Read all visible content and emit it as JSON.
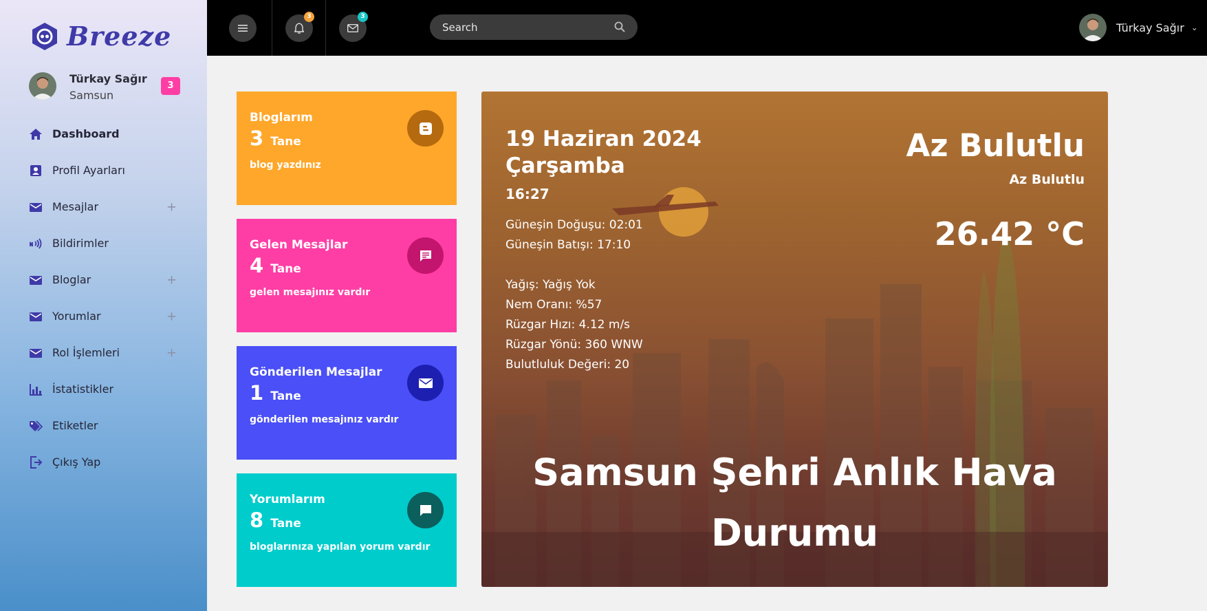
{
  "app": {
    "logo_text": "Breeze"
  },
  "sidebar": {
    "profile": {
      "name": "Türkay Sağır",
      "city": "Samsun",
      "badge": "3"
    },
    "items": [
      {
        "label": "Dashboard",
        "icon": "home-icon",
        "expandable": false
      },
      {
        "label": "Profil Ayarları",
        "icon": "profile-card-icon",
        "expandable": false
      },
      {
        "label": "Mesajlar",
        "icon": "mail-icon",
        "expandable": true
      },
      {
        "label": "Bildirimler",
        "icon": "broadcast-icon",
        "expandable": false
      },
      {
        "label": "Bloglar",
        "icon": "mail-icon",
        "expandable": true
      },
      {
        "label": "Yorumlar",
        "icon": "mail-icon",
        "expandable": true
      },
      {
        "label": "Rol İşlemleri",
        "icon": "mail-icon",
        "expandable": true
      },
      {
        "label": "İstatistikler",
        "icon": "bar-chart-icon",
        "expandable": false
      },
      {
        "label": "Etiketler",
        "icon": "tag-icon",
        "expandable": false
      },
      {
        "label": "Çıkış Yap",
        "icon": "logout-icon",
        "expandable": false
      }
    ],
    "expand_symbol": "+"
  },
  "topbar": {
    "notifications_count": "3",
    "messages_count": "3",
    "search": {
      "placeholder": "Search"
    },
    "user_name": "Türkay Sağır",
    "chevron": "⌄"
  },
  "cards": [
    {
      "title": "Bloglarım",
      "count": "3",
      "unit": "Tane",
      "desc": "blog yazdınız",
      "bg": "#ffa72b",
      "icon_bg": "#b56a10",
      "icon": "blogger-icon"
    },
    {
      "title": "Gelen Mesajlar",
      "count": "4",
      "unit": "Tane",
      "desc": "gelen mesajınız vardır",
      "bg": "#ff3ea5",
      "icon_bg": "#c4156e",
      "icon": "chat-icon"
    },
    {
      "title": "Gönderilen Mesajlar",
      "count": "1",
      "unit": "Tane",
      "desc": "gönderilen mesajınız vardır",
      "bg": "#4a4ff7",
      "icon_bg": "#1d1fb0",
      "icon": "envelope-icon"
    },
    {
      "title": "Yorumlarım",
      "count": "8",
      "unit": "Tane",
      "desc": "bloglarınıza yapılan yorum vardır",
      "bg": "#00cccc",
      "icon_bg": "#0b5f5c",
      "icon": "comment-icon"
    }
  ],
  "weather": {
    "date_line1": "19 Haziran 2024",
    "date_line2": "Çarşamba",
    "time": "16:27",
    "sunrise": "Güneşin Doğuşu: 02:01",
    "sunset": "Güneşin Batışı: 17:10",
    "precip": "Yağış: Yağış Yok",
    "humidity": "Nem Oranı: %57",
    "wind_speed": "Rüzgar Hızı: 4.12 m/s",
    "wind_dir": "Rüzgar Yönü: 360 WNW",
    "cloudiness": "Bulutluluk Değeri: 20",
    "condition": "Az Bulutlu",
    "condition_sub": "Az Bulutlu",
    "temperature": "26.42 °C",
    "headline_line1": "Samsun Şehri Anlık Hava",
    "headline_line2": "Durumu"
  },
  "colors": {
    "topbar": "#000000",
    "badge_pink": "#ff3ea5",
    "badge_orange": "#f6a23a",
    "badge_teal": "#18c6c6",
    "brand": "#3f3aa8"
  }
}
